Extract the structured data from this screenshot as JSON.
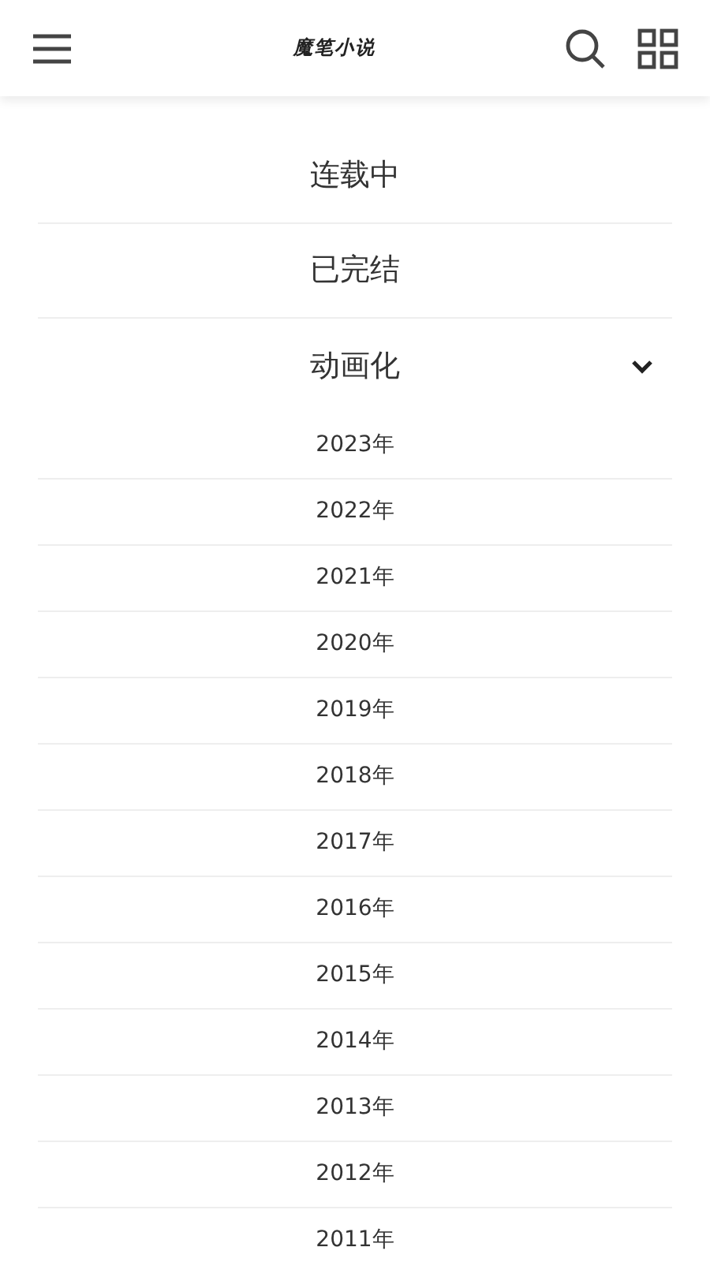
{
  "header": {
    "logo": "魔笔小说"
  },
  "categories": [
    {
      "label": "连载中",
      "kind": "plain"
    },
    {
      "label": "已完结",
      "kind": "plain"
    },
    {
      "label": "动画化",
      "kind": "expandable",
      "expanded": true,
      "children": [
        "2023年",
        "2022年",
        "2021年",
        "2020年",
        "2019年",
        "2018年",
        "2017年",
        "2016年",
        "2015年",
        "2014年",
        "2013年",
        "2012年",
        "2011年"
      ]
    }
  ]
}
